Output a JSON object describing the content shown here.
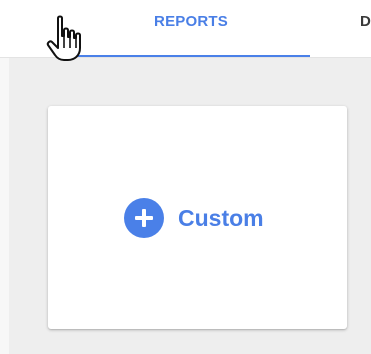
{
  "tabs": {
    "reports_label": "REPORTS",
    "next_label": "D"
  },
  "card": {
    "custom_label": "Custom"
  },
  "icons": {
    "plus": "plus-icon",
    "cursor": "hand-pointer-icon"
  },
  "colors": {
    "accent": "#4a80e8",
    "content_background": "#eeeeee"
  }
}
